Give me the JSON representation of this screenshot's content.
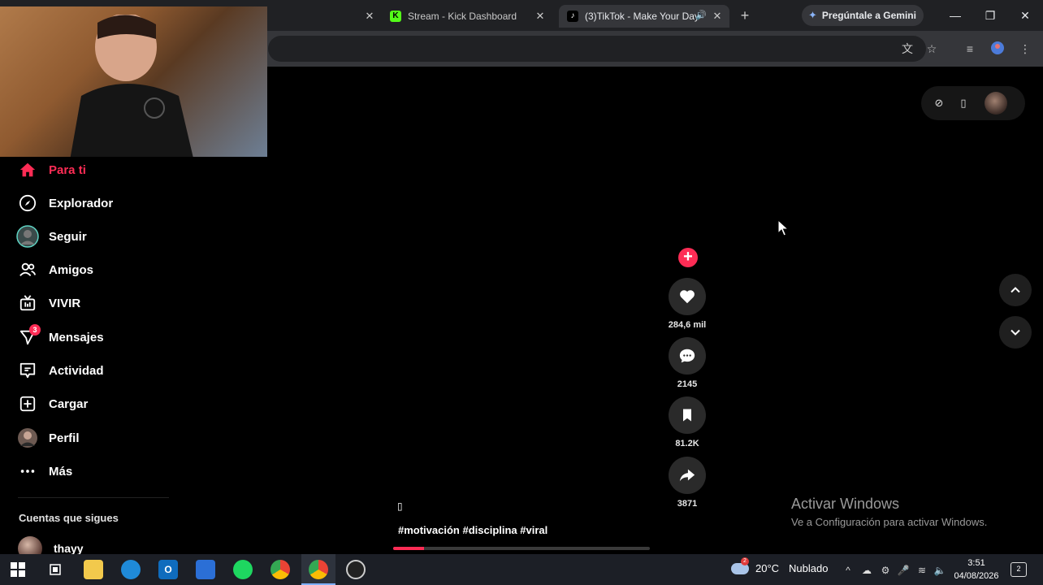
{
  "browser": {
    "tabs": [
      {
        "label": "Stream - Kick Dashboard",
        "icon": "kick-favicon",
        "active": false
      },
      {
        "label": "(3)TikTok - Make Your Day",
        "icon": "tiktok-favicon",
        "active": true
      }
    ],
    "gemini_label": "Pregúntale a Gemini"
  },
  "sidebar": {
    "items": [
      {
        "label": "Para ti",
        "icon": "home-icon",
        "active": true
      },
      {
        "label": "Explorador",
        "icon": "compass-icon"
      },
      {
        "label": "Seguir",
        "icon": "avatar-icon"
      },
      {
        "label": "Amigos",
        "icon": "friends-icon"
      },
      {
        "label": "VIVIR",
        "icon": "live-tv-icon"
      },
      {
        "label": "Mensajes",
        "icon": "send-icon",
        "badge": "3"
      },
      {
        "label": "Actividad",
        "icon": "activity-icon"
      },
      {
        "label": "Cargar",
        "icon": "upload-icon"
      },
      {
        "label": "Perfil",
        "icon": "profile-avatar-icon"
      },
      {
        "label": "Más",
        "icon": "more-dots-icon"
      }
    ],
    "following_header": "Cuentas que sigues",
    "following": [
      {
        "name": "thayy"
      }
    ]
  },
  "video": {
    "likes": "284,6 mil",
    "comments": "2145",
    "saves": "81.2K",
    "shares": "3871",
    "caption_glyph": "▯",
    "caption": "#motivación #disciplina #viral",
    "progress": 0.12
  },
  "watermark": {
    "title": "Activar Windows",
    "subtitle": "Ve a Configuración para activar Windows."
  },
  "taskbar": {
    "weather_temp": "20°C",
    "weather_desc": "Nublado",
    "weather_badge": "2",
    "time": "3:51",
    "date": "04/08/2026",
    "notifications": "2"
  },
  "colors": {
    "accent": "#fe2c55",
    "kick": "#53fc18"
  }
}
